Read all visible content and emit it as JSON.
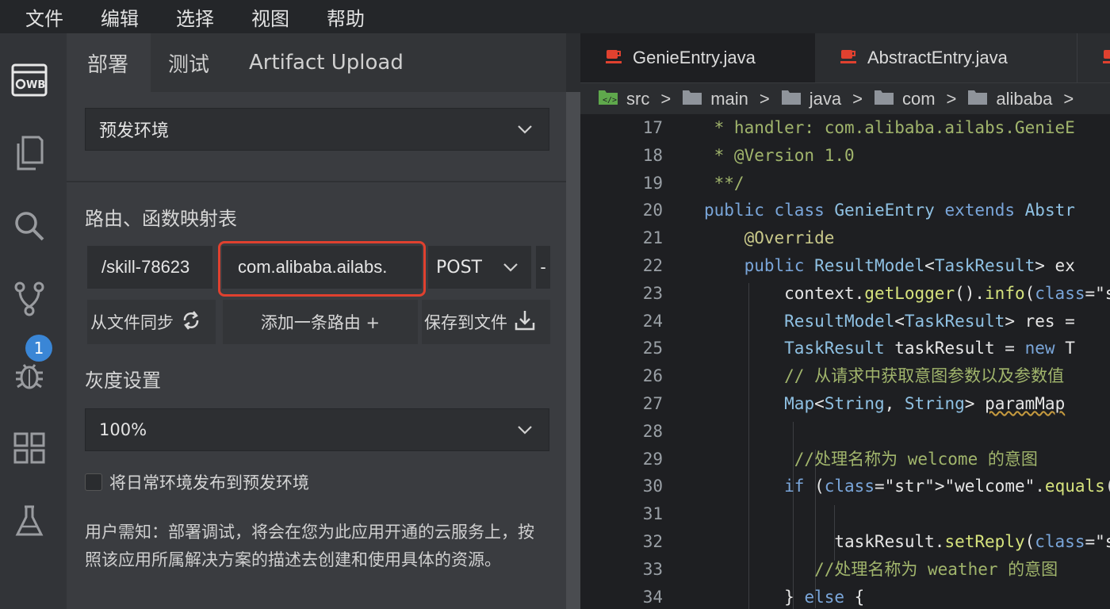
{
  "menu": [
    "文件",
    "编辑",
    "选择",
    "视图",
    "帮助"
  ],
  "activity_bar": {
    "items": [
      "webide-icon",
      "files-icon",
      "search-icon",
      "source-control-icon",
      "debug-icon",
      "extensions-icon",
      "test-icon"
    ],
    "source_control_badge": "1"
  },
  "panel": {
    "tabs": [
      "部署",
      "测试",
      "Artifact Upload"
    ],
    "active_tab": "部署",
    "environment_select": "预发环境",
    "routes_title": "路由、函数映射表",
    "route": {
      "path": "/skill-78623",
      "handler": "com.alibaba.ailabs.",
      "method": "POST",
      "remove": "-"
    },
    "actions": {
      "sync": "从文件同步",
      "add": "添加一条路由 +",
      "save": "保存到文件"
    },
    "gray_title": "灰度设置",
    "gray_select": "100%",
    "publish_checkbox": "将日常环境发布到预发环境",
    "publish_checked": false,
    "note": "用户需知：部署调试，将会在您为此应用开通的云服务上，按照该应用所属解决方案的描述去创建和使用具体的资源。",
    "colors": {
      "highlight_border": "#e0412f",
      "badge": "#3a86d6"
    }
  },
  "editor": {
    "tabs": [
      "GenieEntry.java",
      "AbstractEntry.java"
    ],
    "active_tab": "GenieEntry.java",
    "breadcrumb": [
      "src",
      "main",
      "java",
      "com",
      "alibaba"
    ],
    "lines": [
      {
        "n": "17",
        "text": " * handler: com.alibaba.ailabs.GenieE"
      },
      {
        "n": "18",
        "text": " * @Version 1.0"
      },
      {
        "n": "19",
        "text": " **/"
      },
      {
        "n": "20",
        "text": "public class GenieEntry extends Abstr"
      },
      {
        "n": "21",
        "text": "    @Override"
      },
      {
        "n": "22",
        "text": "    public ResultModel<TaskResult> ex"
      },
      {
        "n": "23",
        "text": "        context.getLogger().info(\"tas"
      },
      {
        "n": "24",
        "text": "        ResultModel<TaskResult> res ="
      },
      {
        "n": "25",
        "text": "        TaskResult taskResult = new T"
      },
      {
        "n": "26",
        "text": "        // 从请求中获取意图参数以及参数值"
      },
      {
        "n": "27",
        "text": "        Map<String, String> paramMap"
      },
      {
        "n": "28",
        "text": ""
      },
      {
        "n": "29",
        "text": "         //处理名称为 welcome 的意图"
      },
      {
        "n": "30",
        "text": "        if (\"welcome\".equals(taskQuer"
      },
      {
        "n": "31",
        "text": ""
      },
      {
        "n": "32",
        "text": "             taskResult.setReply(\"欢迎"
      },
      {
        "n": "33",
        "text": "           //处理名称为 weather 的意图"
      },
      {
        "n": "34",
        "text": "        } else {"
      }
    ]
  }
}
